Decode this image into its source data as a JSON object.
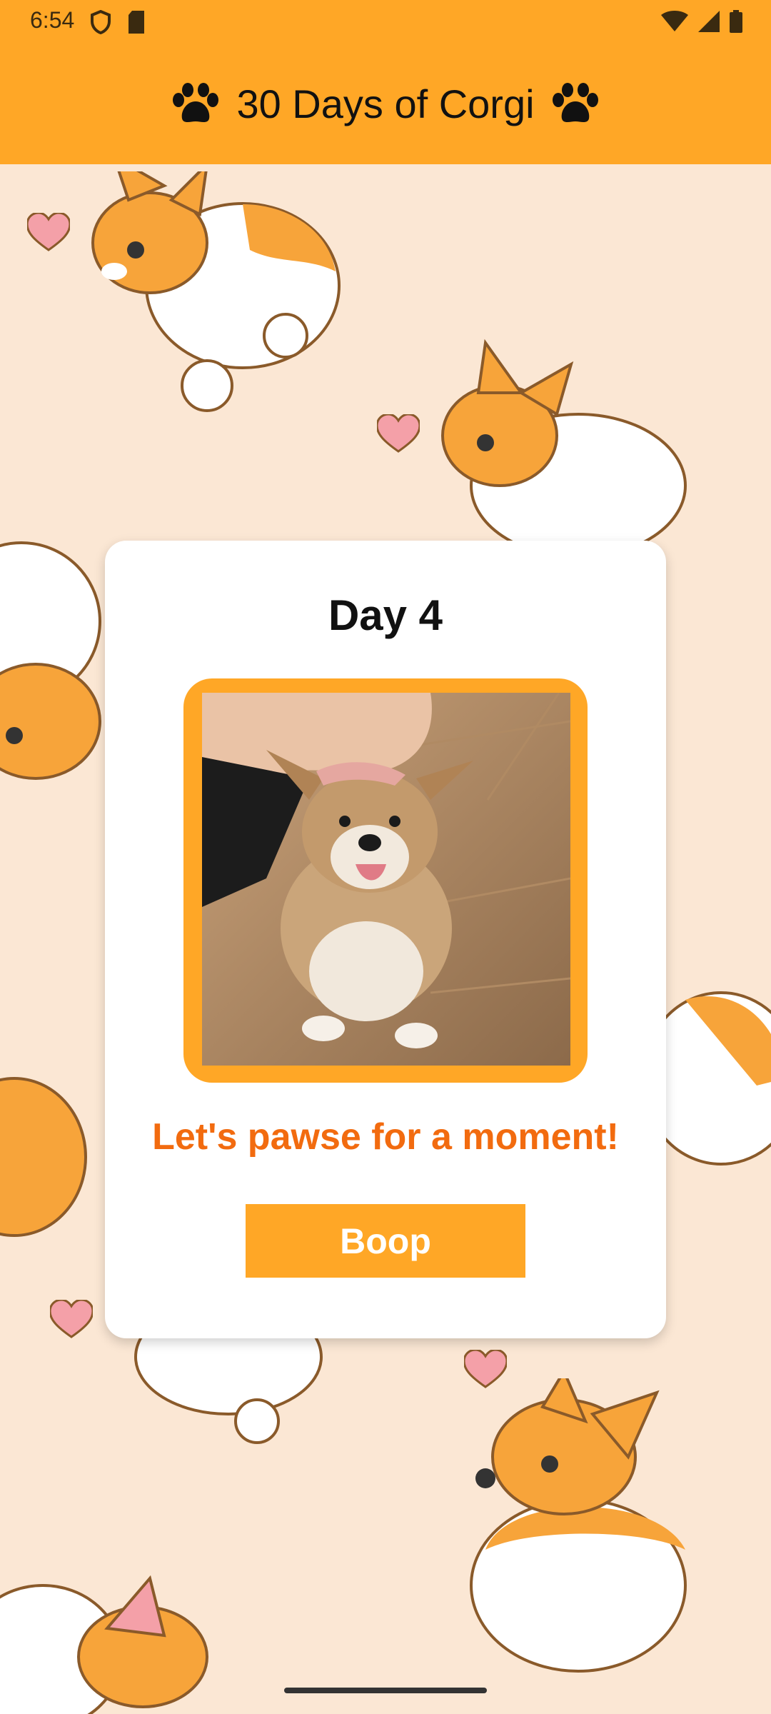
{
  "status_bar": {
    "time": "6:54",
    "left_icons": [
      "shield-icon",
      "sd-card-icon"
    ],
    "right_icons": [
      "wifi-icon",
      "signal-icon",
      "battery-icon"
    ]
  },
  "app_bar": {
    "title": "30 Days of Corgi",
    "icons": [
      "paw-icon",
      "paw-icon"
    ],
    "color": "#ffa726"
  },
  "card": {
    "day_label": "Day 4",
    "caption": "Let's pawse for a moment!",
    "button_label": "Boop",
    "photo_description_icon": "corgi-puppy-photo"
  },
  "colors": {
    "accent": "#ffa726",
    "caption": "#f26b0f",
    "background": "#fbe7d4"
  }
}
